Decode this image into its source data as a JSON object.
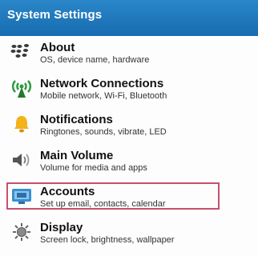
{
  "header": {
    "title": "System Settings"
  },
  "items": [
    {
      "title": "About",
      "subtitle": "OS, device name, hardware",
      "icon": "blackberry-logo-icon",
      "selected": false
    },
    {
      "title": "Network Connections",
      "subtitle": "Mobile network, Wi-Fi, Bluetooth",
      "icon": "network-antenna-icon",
      "selected": false
    },
    {
      "title": "Notifications",
      "subtitle": "Ringtones, sounds, vibrate, LED",
      "icon": "bell-icon",
      "selected": false
    },
    {
      "title": "Main Volume",
      "subtitle": "Volume for media and apps",
      "icon": "speaker-icon",
      "selected": false
    },
    {
      "title": "Accounts",
      "subtitle": "Set up email, contacts, calendar",
      "icon": "accounts-monitor-icon",
      "selected": true
    },
    {
      "title": "Display",
      "subtitle": "Screen lock, brightness, wallpaper",
      "icon": "display-brightness-icon",
      "selected": false
    }
  ],
  "colors": {
    "header": "#1873b8",
    "selection_border": "#c4516d"
  }
}
